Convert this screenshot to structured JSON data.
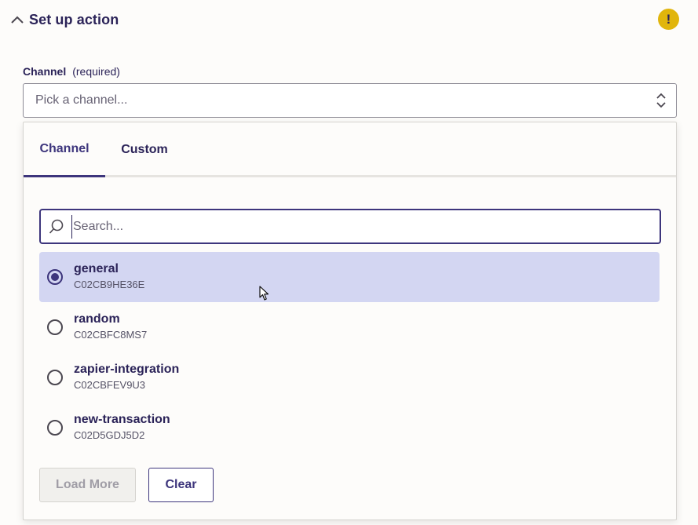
{
  "section": {
    "title": "Set up action",
    "warning_glyph": "!",
    "warning_color": "#e1b50c"
  },
  "field": {
    "label": "Channel",
    "required_text": "(required)",
    "placeholder": "Pick a channel..."
  },
  "dropdown": {
    "tabs": [
      {
        "label": "Channel",
        "active": true
      },
      {
        "label": "Custom",
        "active": false
      }
    ],
    "search": {
      "placeholder": "Search...",
      "value": ""
    },
    "options": [
      {
        "name": "general",
        "id": "C02CB9HE36E",
        "selected": true
      },
      {
        "name": "random",
        "id": "C02CBFC8MS7",
        "selected": false
      },
      {
        "name": "zapier-integration",
        "id": "C02CBFEV9U3",
        "selected": false
      },
      {
        "name": "new-transaction",
        "id": "C02D5GDJ5D2",
        "selected": false
      }
    ],
    "buttons": {
      "load_more": "Load More",
      "clear": "Clear"
    }
  },
  "colors": {
    "accent": "#3d357c",
    "text": "#2b2358",
    "selected_bg": "#d3d6f2"
  }
}
